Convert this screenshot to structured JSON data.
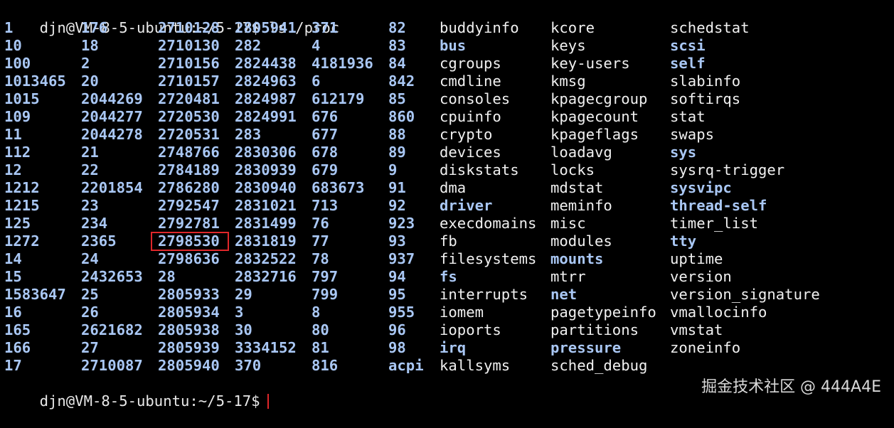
{
  "terminal": {
    "command_line": "djn@VM-8-5-ubuntu:~/5-17$ ls /proc",
    "final_prompt": "djn@VM-8-5-ubuntu:~/5-17$",
    "highlighted_entry": "2798530",
    "columns": [
      [
        {
          "name": "1",
          "kind": "dir"
        },
        {
          "name": "10",
          "kind": "dir"
        },
        {
          "name": "100",
          "kind": "dir"
        },
        {
          "name": "1013465",
          "kind": "dir"
        },
        {
          "name": "1015",
          "kind": "dir"
        },
        {
          "name": "109",
          "kind": "dir"
        },
        {
          "name": "11",
          "kind": "dir"
        },
        {
          "name": "112",
          "kind": "dir"
        },
        {
          "name": "12",
          "kind": "dir"
        },
        {
          "name": "1212",
          "kind": "dir"
        },
        {
          "name": "1215",
          "kind": "dir"
        },
        {
          "name": "125",
          "kind": "dir"
        },
        {
          "name": "1272",
          "kind": "dir"
        },
        {
          "name": "14",
          "kind": "dir"
        },
        {
          "name": "15",
          "kind": "dir"
        },
        {
          "name": "1583647",
          "kind": "dir"
        },
        {
          "name": "16",
          "kind": "dir"
        },
        {
          "name": "165",
          "kind": "dir"
        },
        {
          "name": "166",
          "kind": "dir"
        },
        {
          "name": "17",
          "kind": "dir"
        }
      ],
      [
        {
          "name": "176",
          "kind": "dir"
        },
        {
          "name": "18",
          "kind": "dir"
        },
        {
          "name": "2",
          "kind": "dir"
        },
        {
          "name": "20",
          "kind": "dir"
        },
        {
          "name": "2044269",
          "kind": "dir"
        },
        {
          "name": "2044277",
          "kind": "dir"
        },
        {
          "name": "2044278",
          "kind": "dir"
        },
        {
          "name": "21",
          "kind": "dir"
        },
        {
          "name": "22",
          "kind": "dir"
        },
        {
          "name": "2201854",
          "kind": "dir"
        },
        {
          "name": "23",
          "kind": "dir"
        },
        {
          "name": "234",
          "kind": "dir"
        },
        {
          "name": "2365",
          "kind": "dir"
        },
        {
          "name": "24",
          "kind": "dir"
        },
        {
          "name": "2432653",
          "kind": "dir"
        },
        {
          "name": "25",
          "kind": "dir"
        },
        {
          "name": "26",
          "kind": "dir"
        },
        {
          "name": "2621682",
          "kind": "dir"
        },
        {
          "name": "27",
          "kind": "dir"
        },
        {
          "name": "2710087",
          "kind": "dir"
        }
      ],
      [
        {
          "name": "2710128",
          "kind": "dir"
        },
        {
          "name": "2710130",
          "kind": "dir"
        },
        {
          "name": "2710156",
          "kind": "dir"
        },
        {
          "name": "2710157",
          "kind": "dir"
        },
        {
          "name": "2720481",
          "kind": "dir"
        },
        {
          "name": "2720530",
          "kind": "dir"
        },
        {
          "name": "2720531",
          "kind": "dir"
        },
        {
          "name": "2748766",
          "kind": "dir"
        },
        {
          "name": "2784189",
          "kind": "dir"
        },
        {
          "name": "2786280",
          "kind": "dir"
        },
        {
          "name": "2792547",
          "kind": "dir"
        },
        {
          "name": "2792781",
          "kind": "dir"
        },
        {
          "name": "2798530",
          "kind": "dir"
        },
        {
          "name": "2798636",
          "kind": "dir"
        },
        {
          "name": "28",
          "kind": "dir"
        },
        {
          "name": "2805933",
          "kind": "dir"
        },
        {
          "name": "2805934",
          "kind": "dir"
        },
        {
          "name": "2805938",
          "kind": "dir"
        },
        {
          "name": "2805939",
          "kind": "dir"
        },
        {
          "name": "2805940",
          "kind": "dir"
        }
      ],
      [
        {
          "name": "2805941",
          "kind": "dir"
        },
        {
          "name": "282",
          "kind": "dir"
        },
        {
          "name": "2824438",
          "kind": "dir"
        },
        {
          "name": "2824963",
          "kind": "dir"
        },
        {
          "name": "2824987",
          "kind": "dir"
        },
        {
          "name": "2824991",
          "kind": "dir"
        },
        {
          "name": "283",
          "kind": "dir"
        },
        {
          "name": "2830306",
          "kind": "dir"
        },
        {
          "name": "2830939",
          "kind": "dir"
        },
        {
          "name": "2830940",
          "kind": "dir"
        },
        {
          "name": "2831021",
          "kind": "dir"
        },
        {
          "name": "2831499",
          "kind": "dir"
        },
        {
          "name": "2831819",
          "kind": "dir"
        },
        {
          "name": "2832522",
          "kind": "dir"
        },
        {
          "name": "2832716",
          "kind": "dir"
        },
        {
          "name": "29",
          "kind": "dir"
        },
        {
          "name": "3",
          "kind": "dir"
        },
        {
          "name": "30",
          "kind": "dir"
        },
        {
          "name": "3334152",
          "kind": "dir"
        },
        {
          "name": "370",
          "kind": "dir"
        }
      ],
      [
        {
          "name": "371",
          "kind": "dir"
        },
        {
          "name": "4",
          "kind": "dir"
        },
        {
          "name": "4181936",
          "kind": "dir"
        },
        {
          "name": "6",
          "kind": "dir"
        },
        {
          "name": "612179",
          "kind": "dir"
        },
        {
          "name": "676",
          "kind": "dir"
        },
        {
          "name": "677",
          "kind": "dir"
        },
        {
          "name": "678",
          "kind": "dir"
        },
        {
          "name": "679",
          "kind": "dir"
        },
        {
          "name": "683673",
          "kind": "dir"
        },
        {
          "name": "713",
          "kind": "dir"
        },
        {
          "name": "76",
          "kind": "dir"
        },
        {
          "name": "77",
          "kind": "dir"
        },
        {
          "name": "78",
          "kind": "dir"
        },
        {
          "name": "797",
          "kind": "dir"
        },
        {
          "name": "799",
          "kind": "dir"
        },
        {
          "name": "8",
          "kind": "dir"
        },
        {
          "name": "80",
          "kind": "dir"
        },
        {
          "name": "81",
          "kind": "dir"
        },
        {
          "name": "816",
          "kind": "dir"
        }
      ],
      [
        {
          "name": "82",
          "kind": "dir"
        },
        {
          "name": "83",
          "kind": "dir"
        },
        {
          "name": "84",
          "kind": "dir"
        },
        {
          "name": "842",
          "kind": "dir"
        },
        {
          "name": "85",
          "kind": "dir"
        },
        {
          "name": "860",
          "kind": "dir"
        },
        {
          "name": "88",
          "kind": "dir"
        },
        {
          "name": "89",
          "kind": "dir"
        },
        {
          "name": "9",
          "kind": "dir"
        },
        {
          "name": "91",
          "kind": "dir"
        },
        {
          "name": "92",
          "kind": "dir"
        },
        {
          "name": "923",
          "kind": "dir"
        },
        {
          "name": "93",
          "kind": "dir"
        },
        {
          "name": "937",
          "kind": "dir"
        },
        {
          "name": "94",
          "kind": "dir"
        },
        {
          "name": "95",
          "kind": "dir"
        },
        {
          "name": "955",
          "kind": "dir"
        },
        {
          "name": "96",
          "kind": "dir"
        },
        {
          "name": "98",
          "kind": "dir"
        },
        {
          "name": "acpi",
          "kind": "dir"
        }
      ],
      [
        {
          "name": "buddyinfo",
          "kind": "file"
        },
        {
          "name": "bus",
          "kind": "dir"
        },
        {
          "name": "cgroups",
          "kind": "file"
        },
        {
          "name": "cmdline",
          "kind": "file"
        },
        {
          "name": "consoles",
          "kind": "file"
        },
        {
          "name": "cpuinfo",
          "kind": "file"
        },
        {
          "name": "crypto",
          "kind": "file"
        },
        {
          "name": "devices",
          "kind": "file"
        },
        {
          "name": "diskstats",
          "kind": "file"
        },
        {
          "name": "dma",
          "kind": "file"
        },
        {
          "name": "driver",
          "kind": "dir"
        },
        {
          "name": "execdomains",
          "kind": "file"
        },
        {
          "name": "fb",
          "kind": "file"
        },
        {
          "name": "filesystems",
          "kind": "file"
        },
        {
          "name": "fs",
          "kind": "dir"
        },
        {
          "name": "interrupts",
          "kind": "file"
        },
        {
          "name": "iomem",
          "kind": "file"
        },
        {
          "name": "ioports",
          "kind": "file"
        },
        {
          "name": "irq",
          "kind": "dir"
        },
        {
          "name": "kallsyms",
          "kind": "file"
        }
      ],
      [
        {
          "name": "kcore",
          "kind": "file"
        },
        {
          "name": "keys",
          "kind": "file"
        },
        {
          "name": "key-users",
          "kind": "file"
        },
        {
          "name": "kmsg",
          "kind": "file"
        },
        {
          "name": "kpagecgroup",
          "kind": "file"
        },
        {
          "name": "kpagecount",
          "kind": "file"
        },
        {
          "name": "kpageflags",
          "kind": "file"
        },
        {
          "name": "loadavg",
          "kind": "file"
        },
        {
          "name": "locks",
          "kind": "file"
        },
        {
          "name": "mdstat",
          "kind": "file"
        },
        {
          "name": "meminfo",
          "kind": "file"
        },
        {
          "name": "misc",
          "kind": "file"
        },
        {
          "name": "modules",
          "kind": "file"
        },
        {
          "name": "mounts",
          "kind": "dir"
        },
        {
          "name": "mtrr",
          "kind": "file"
        },
        {
          "name": "net",
          "kind": "dir"
        },
        {
          "name": "pagetypeinfo",
          "kind": "file"
        },
        {
          "name": "partitions",
          "kind": "file"
        },
        {
          "name": "pressure",
          "kind": "dir"
        },
        {
          "name": "sched_debug",
          "kind": "file"
        }
      ],
      [
        {
          "name": "schedstat",
          "kind": "file"
        },
        {
          "name": "scsi",
          "kind": "dir"
        },
        {
          "name": "self",
          "kind": "dir"
        },
        {
          "name": "slabinfo",
          "kind": "file"
        },
        {
          "name": "softirqs",
          "kind": "file"
        },
        {
          "name": "stat",
          "kind": "file"
        },
        {
          "name": "swaps",
          "kind": "file"
        },
        {
          "name": "sys",
          "kind": "dir"
        },
        {
          "name": "sysrq-trigger",
          "kind": "file"
        },
        {
          "name": "sysvipc",
          "kind": "dir"
        },
        {
          "name": "thread-self",
          "kind": "dir"
        },
        {
          "name": "timer_list",
          "kind": "file"
        },
        {
          "name": "tty",
          "kind": "dir"
        },
        {
          "name": "uptime",
          "kind": "file"
        },
        {
          "name": "version",
          "kind": "file"
        },
        {
          "name": "version_signature",
          "kind": "file"
        },
        {
          "name": "vmallocinfo",
          "kind": "file"
        },
        {
          "name": "vmstat",
          "kind": "file"
        },
        {
          "name": "zoneinfo",
          "kind": "file"
        }
      ]
    ]
  },
  "watermark": "掘金技术社区 @ 444A4E",
  "colors": {
    "background": "#000000",
    "text": "#f0f0f0",
    "directory": "#a9c7f4",
    "highlight_border": "#e0262a",
    "cursor": "#e0262a"
  }
}
